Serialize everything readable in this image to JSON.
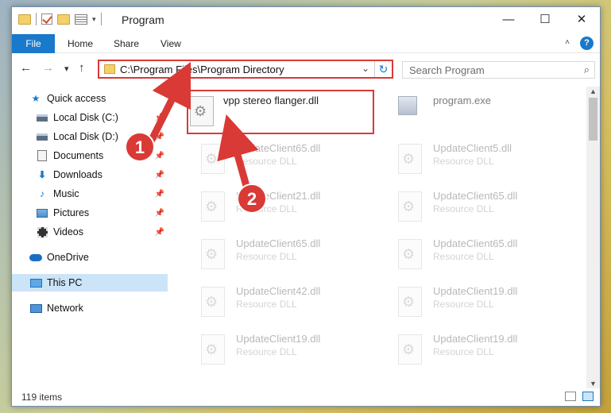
{
  "window": {
    "title": "Program"
  },
  "titlebar": {
    "minimize": "—",
    "maximize": "☐",
    "close": "✕",
    "qat_dropdown": "▾"
  },
  "ribbon": {
    "tabs": [
      "File",
      "Home",
      "Share",
      "View"
    ],
    "help": "?",
    "collapse": "˄"
  },
  "nav": {
    "back": "←",
    "forward": "→",
    "recent": "▾",
    "up": "↑",
    "address": "C:\\Program Files\\Program Directory",
    "address_dropdown": "⌄",
    "refresh": "↻",
    "search_placeholder": "Search Program",
    "search_icon": "⌕"
  },
  "sidebar": {
    "items": [
      {
        "label": "Quick access",
        "icon": "star-icon"
      },
      {
        "label": "Local Disk (C:)",
        "icon": "disk-icon",
        "pin": "📌"
      },
      {
        "label": "Local Disk (D:)",
        "icon": "disk-icon",
        "pin": "📌"
      },
      {
        "label": "Documents",
        "icon": "document-icon",
        "pin": "📌"
      },
      {
        "label": "Downloads",
        "icon": "download-icon",
        "pin": "📌"
      },
      {
        "label": "Music",
        "icon": "music-icon",
        "pin": "📌"
      },
      {
        "label": "Pictures",
        "icon": "pictures-icon",
        "pin": "📌"
      },
      {
        "label": "Videos",
        "icon": "videos-icon",
        "pin": "📌"
      },
      {
        "label": "OneDrive",
        "icon": "cloud-icon"
      },
      {
        "label": "This PC",
        "icon": "pc-icon",
        "selected": true
      },
      {
        "label": "Network",
        "icon": "network-icon"
      }
    ]
  },
  "files": {
    "highlighted": {
      "name": "vpp stereo flanger.dll"
    },
    "exe": {
      "name": "program.exe"
    },
    "left": [
      {
        "name": "UpdateClient65.dll",
        "type": "Resource DLL"
      },
      {
        "name": "UpdateClient21.dll",
        "type": "Resource DLL"
      },
      {
        "name": "UpdateClient65.dll",
        "type": "Resource DLL"
      },
      {
        "name": "UpdateClient42.dll",
        "type": "Resource DLL"
      },
      {
        "name": "UpdateClient19.dll",
        "type": "Resource DLL"
      }
    ],
    "right": [
      {
        "name": "UpdateClient5.dll",
        "type": "Resource DLL"
      },
      {
        "name": "UpdateClient65.dll",
        "type": "Resource DLL"
      },
      {
        "name": "UpdateClient65.dll",
        "type": "Resource DLL"
      },
      {
        "name": "UpdateClient19.dll",
        "type": "Resource DLL"
      },
      {
        "name": "UpdateClient19.dll",
        "type": "Resource DLL"
      }
    ]
  },
  "statusbar": {
    "item_count": "119 items"
  },
  "annotations": {
    "step1": "1",
    "step2": "2",
    "color": "#d93a35"
  },
  "colors": {
    "accent": "#1979ca",
    "highlight": "#d93a35",
    "selected": "#cce4f7"
  }
}
